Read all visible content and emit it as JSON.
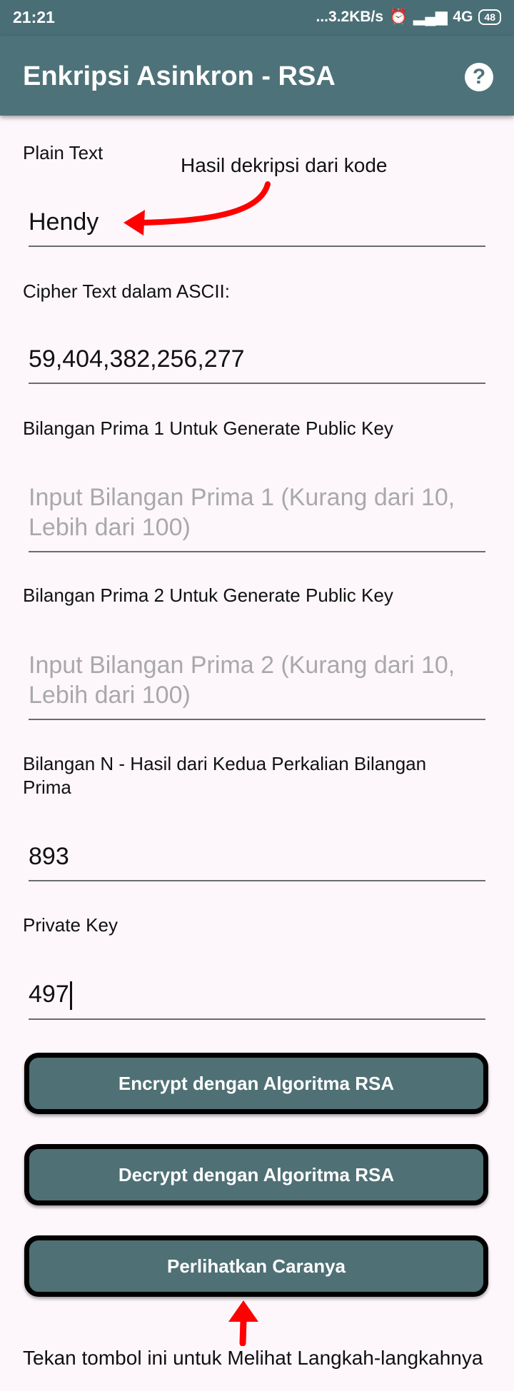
{
  "status": {
    "time": "21:21",
    "speed": "...3.2KB/s",
    "net": "4G",
    "battery": "48"
  },
  "app": {
    "title": "Enkripsi Asinkron - RSA"
  },
  "icons": {
    "help": "help-icon"
  },
  "form": {
    "plain_label": "Plain Text",
    "plain_value": "Hendy",
    "cipher_label": "Cipher Text dalam ASCII:",
    "cipher_value": "59,404,382,256,277",
    "prime1_label": "Bilangan Prima 1 Untuk Generate Public Key",
    "prime1_hint": "Input Bilangan Prima 1 (Kurang dari 10, Lebih dari 100)",
    "prime2_label": "Bilangan Prima 2 Untuk Generate Public Key",
    "prime2_hint": "Input Bilangan Prima 2 (Kurang dari 10, Lebih dari 100)",
    "n_label": "Bilangan N - Hasil dari Kedua Perkalian Bilangan Prima",
    "n_value": "893",
    "private_label": "Private Key",
    "private_value": "497"
  },
  "buttons": {
    "encrypt": "Encrypt dengan Algoritma RSA",
    "decrypt": "Decrypt dengan Algoritma RSA",
    "show": "Perlihatkan Caranya"
  },
  "annotations": {
    "top": "Hasil dekripsi dari kode",
    "bottom": "Tekan tombol ini untuk Melihat Langkah-langkahnya"
  },
  "colors": {
    "appbar": "#4e7279",
    "button": "#4f7075",
    "arrow": "#ff0000"
  }
}
